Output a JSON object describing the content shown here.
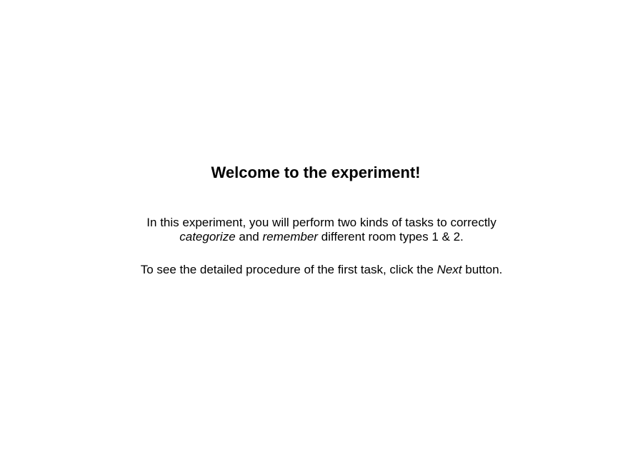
{
  "title": "Welcome to the experiment!",
  "intro": {
    "line1": "In this experiment, you will perform two kinds of tasks to correctly",
    "word_categorize": "categorize",
    "word_and": " and ",
    "word_remember": "remember",
    "line2_rest": " different room types 1 & 2."
  },
  "procedure": {
    "before": "To see the detailed procedure of the first task, click the ",
    "next_word": "Next",
    "after": " button."
  }
}
